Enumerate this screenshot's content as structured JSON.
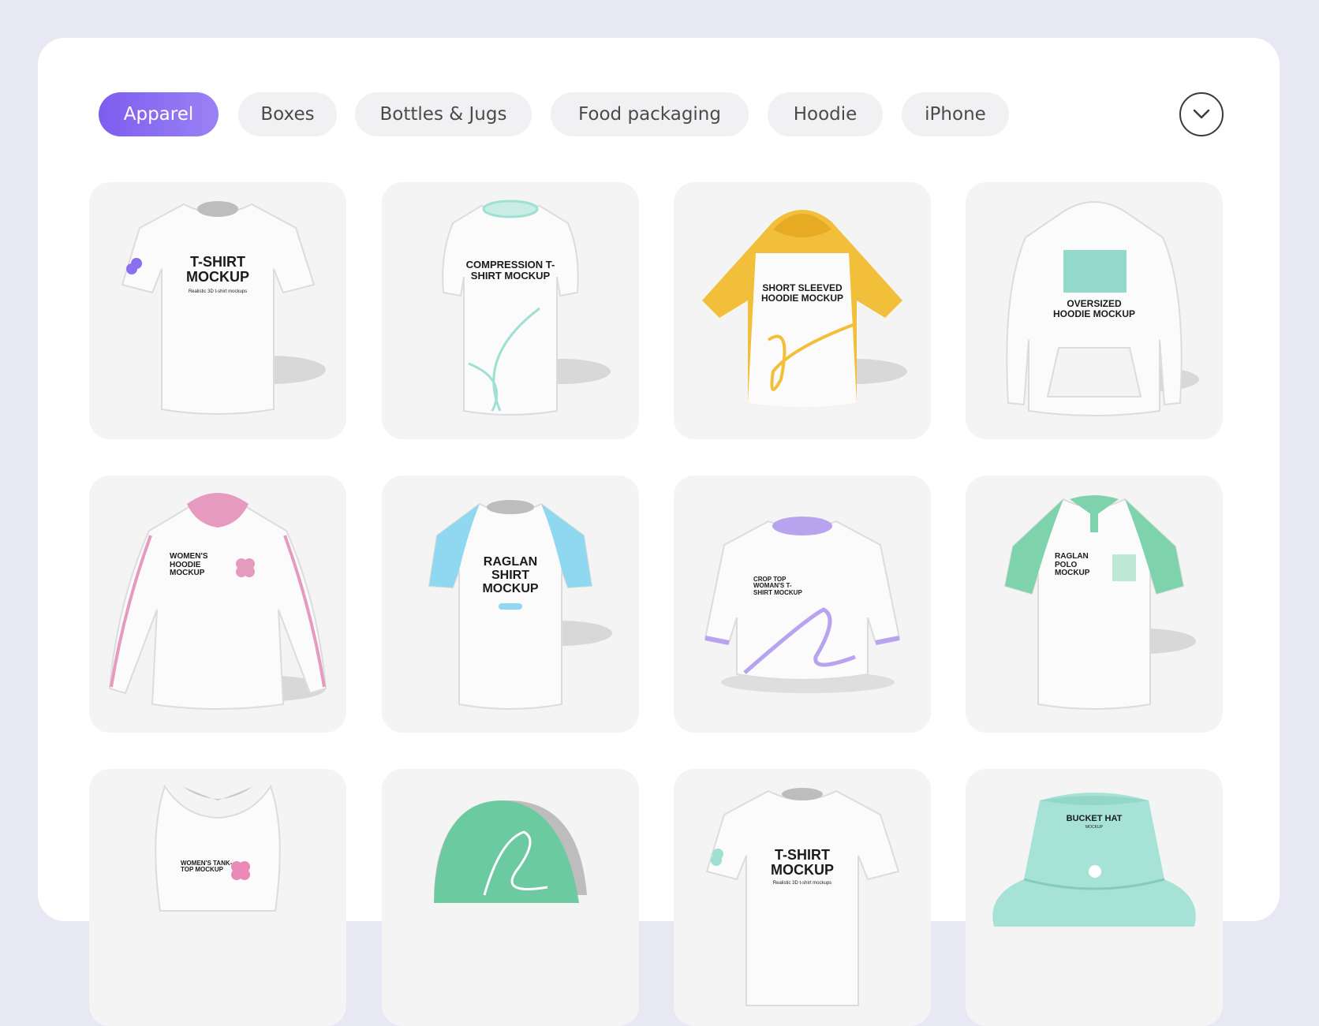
{
  "filters": [
    {
      "label": "Apparel",
      "active": true
    },
    {
      "label": "Boxes",
      "active": false
    },
    {
      "label": "Bottles & Jugs",
      "active": false
    },
    {
      "label": "Food packaging",
      "active": false
    },
    {
      "label": "Hoodie",
      "active": false
    },
    {
      "label": "iPhone",
      "active": false
    }
  ],
  "accent": "#8166f1",
  "expand_icon": "chevron-down-icon",
  "cards": [
    {
      "text": "T-SHIRT MOCKUP",
      "sub": "Realistic 3D t-shirt mockups",
      "accent": "#8a6ff0"
    },
    {
      "text": "COMPRESSION T-SHIRT MOCKUP",
      "accent": "#9ee0d2"
    },
    {
      "text": "SHORT SLEEVED HOODIE MOCKUP",
      "accent": "#f2bf3a"
    },
    {
      "text": "OVERSIZED HOODIE MOCKUP",
      "accent": "#93d9cc"
    },
    {
      "text": "WOMEN'S HOODIE MOCKUP",
      "accent": "#e79ac0"
    },
    {
      "text": "RAGLAN SHIRT MOCKUP",
      "accent": "#8fd8f0"
    },
    {
      "text": "CROP TOP WOMAN'S T-SHIRT MOCKUP",
      "accent": "#b8a3ee"
    },
    {
      "text": "RAGLAN POLO MOCKUP",
      "accent": "#7fd3ac"
    },
    {
      "text": "WOMEN'S TANK-TOP MOCKUP",
      "accent": "#e98ab8"
    },
    {
      "text": "",
      "accent": "#6ccaa0"
    },
    {
      "text": "T-SHIRT MOCKUP",
      "sub": "Realistic 3D t-shirt mockups",
      "accent": "#9ee0d2"
    },
    {
      "text": "BUCKET HAT",
      "sub": "MOCKUP",
      "accent": "#a6e3d6"
    }
  ]
}
